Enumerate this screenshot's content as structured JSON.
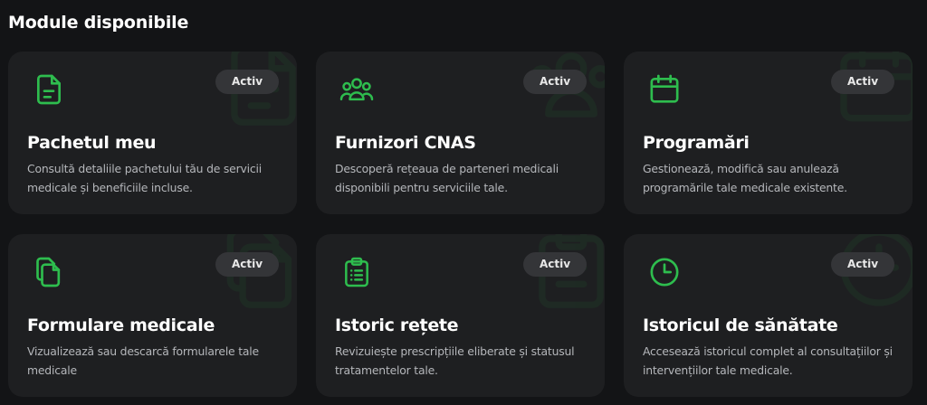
{
  "section_title": "Module disponibile",
  "accent_color": "#2ebd4e",
  "modules": [
    {
      "icon": "document-icon",
      "badge": "Activ",
      "title": "Pachetul meu",
      "description": "Consultă detaliile pachetului tău de servicii medicale și beneficiile incluse."
    },
    {
      "icon": "people-group-icon",
      "badge": "Activ",
      "title": "Furnizori CNAS",
      "description": "Descoperă rețeaua de parteneri medicali disponibili pentru serviciile tale."
    },
    {
      "icon": "calendar-icon",
      "badge": "Activ",
      "title": "Programări",
      "description": "Gestionează, modifică sau anulează programările tale medicale existente."
    },
    {
      "icon": "files-copy-icon",
      "badge": "Activ",
      "title": "Formulare medicale",
      "description": "Vizualizează sau descarcă formularele tale medicale"
    },
    {
      "icon": "clipboard-list-icon",
      "badge": "Activ",
      "title": "Istoric rețete",
      "description": "Revizuiește prescripțiile eliberate și statusul tratamentelor tale."
    },
    {
      "icon": "clock-icon",
      "badge": "Activ",
      "title": "Istoricul de sănătate",
      "description": "Accesează istoricul complet al consultațiilor și intervențiilor tale medicale."
    }
  ]
}
